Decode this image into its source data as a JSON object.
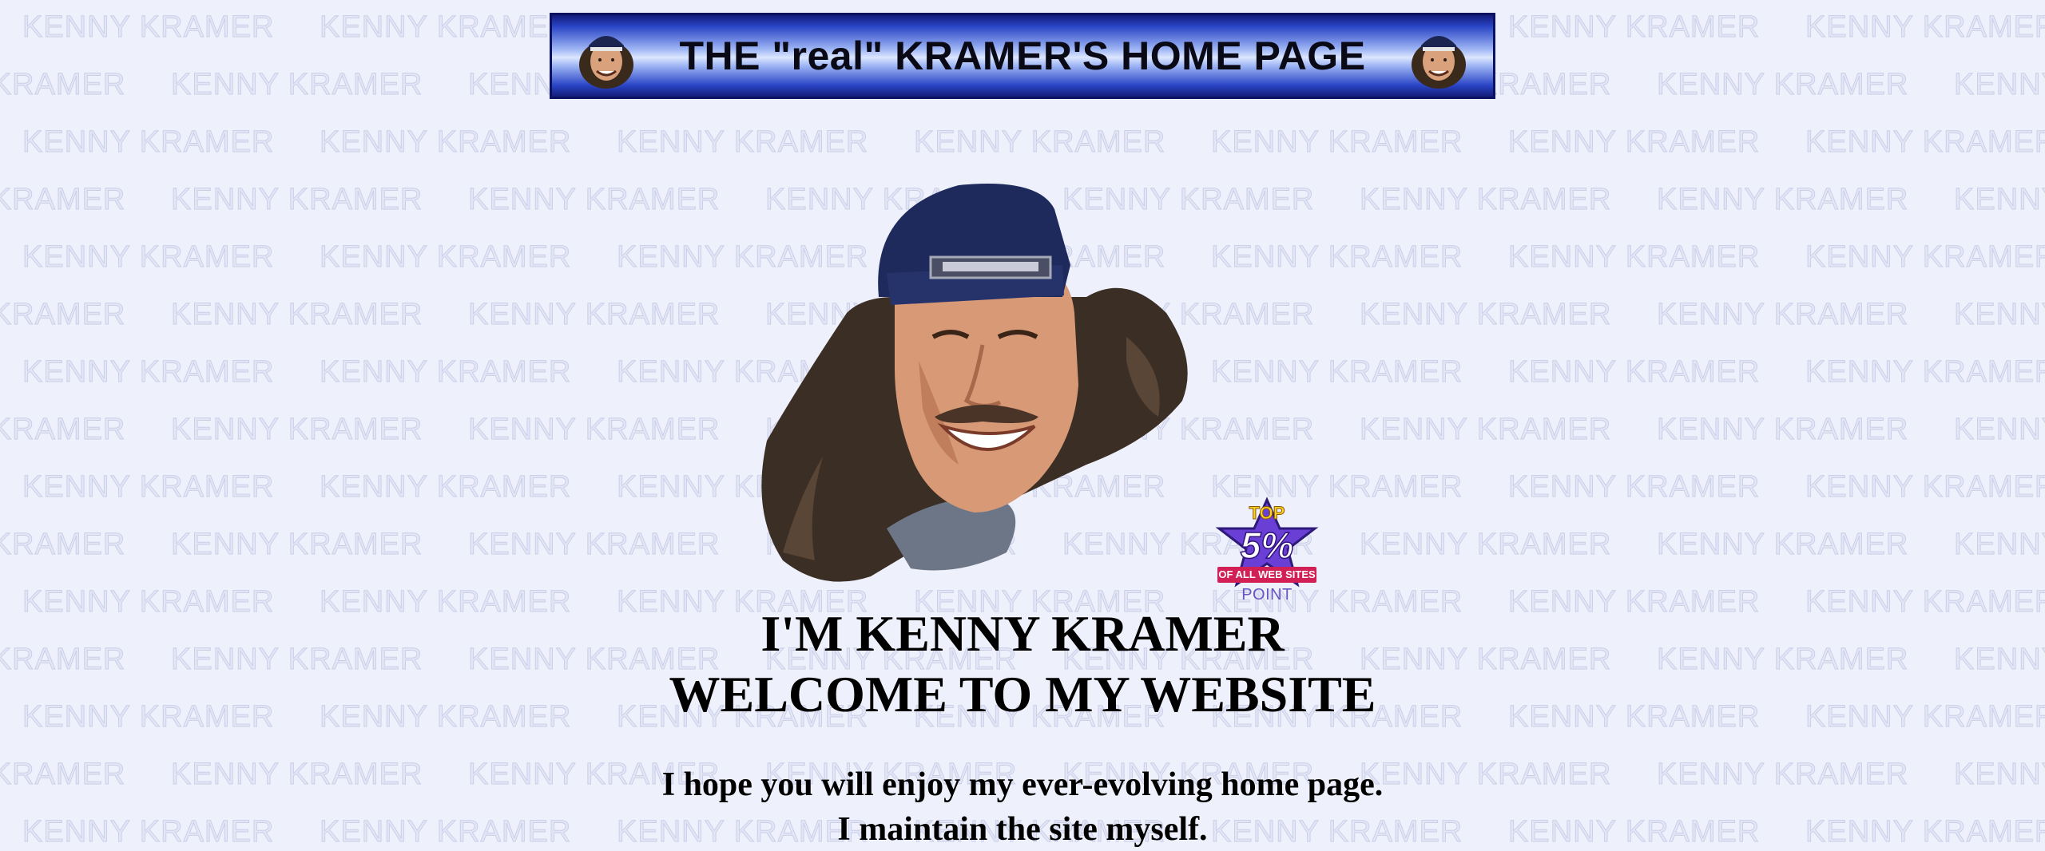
{
  "watermark": {
    "text": "KENNY KRAMER"
  },
  "banner": {
    "title": "THE \"real\" KRAMER'S HOME PAGE"
  },
  "badge": {
    "top_label": "TOP",
    "main_label": "5%",
    "ribbon_label": "OF ALL WEB SITES",
    "brand_label": "POINT"
  },
  "main": {
    "heading_name": "I'M KENNY KRAMER",
    "heading_welcome": "WELCOME TO MY WEBSITE",
    "intro_line_1": "I hope you will enjoy my ever-evolving home page.",
    "intro_line_2": "I maintain the site myself."
  },
  "colors": {
    "background": "#eef0fb",
    "banner_blue": "#2a45c6",
    "badge_star": "#6a3fd6",
    "badge_ribbon": "#d21f55"
  }
}
